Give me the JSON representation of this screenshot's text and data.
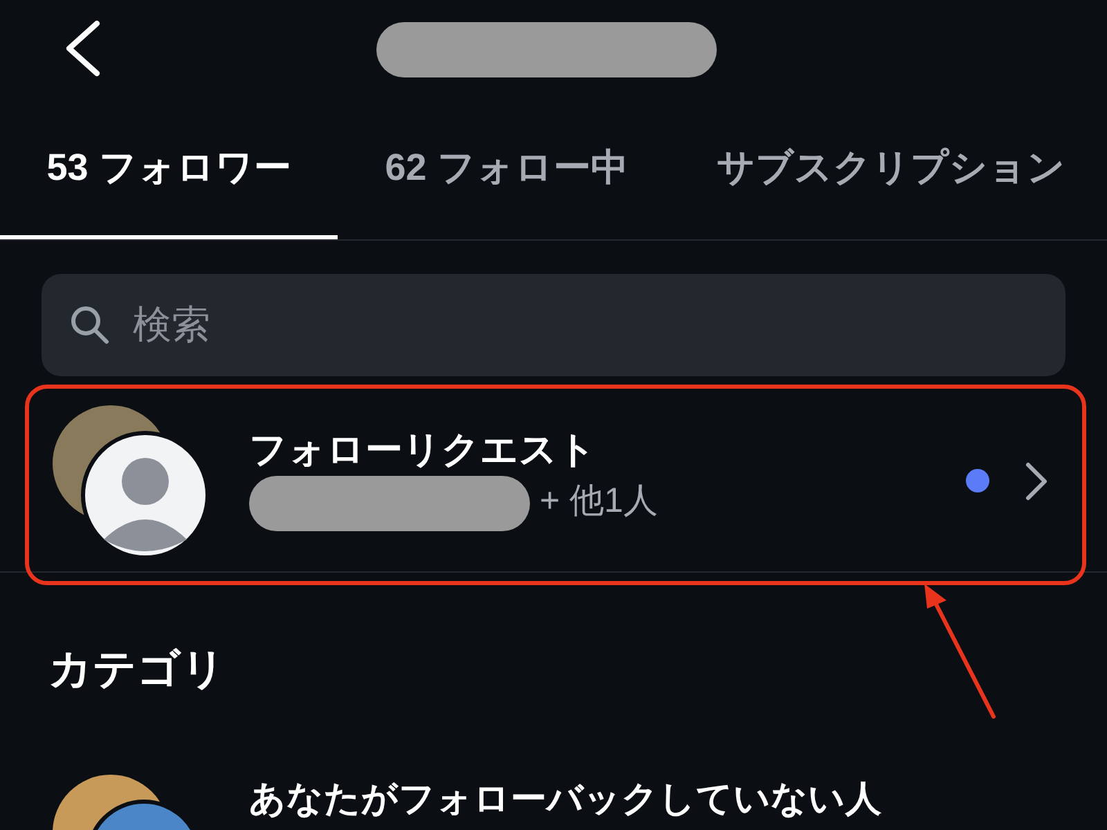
{
  "tabs": [
    {
      "label": "53 フォロワー",
      "selected": true
    },
    {
      "label": "62 フォロー中",
      "selected": false
    },
    {
      "label": "サブスクリプション",
      "selected": false
    }
  ],
  "search": {
    "placeholder": "検索"
  },
  "follow_request": {
    "title": "フォローリクエスト",
    "others": "+ 他1人",
    "unread": true
  },
  "category": {
    "heading": "カテゴリ",
    "items": [
      {
        "label": "あなたがフォローバックしていない人"
      }
    ]
  }
}
